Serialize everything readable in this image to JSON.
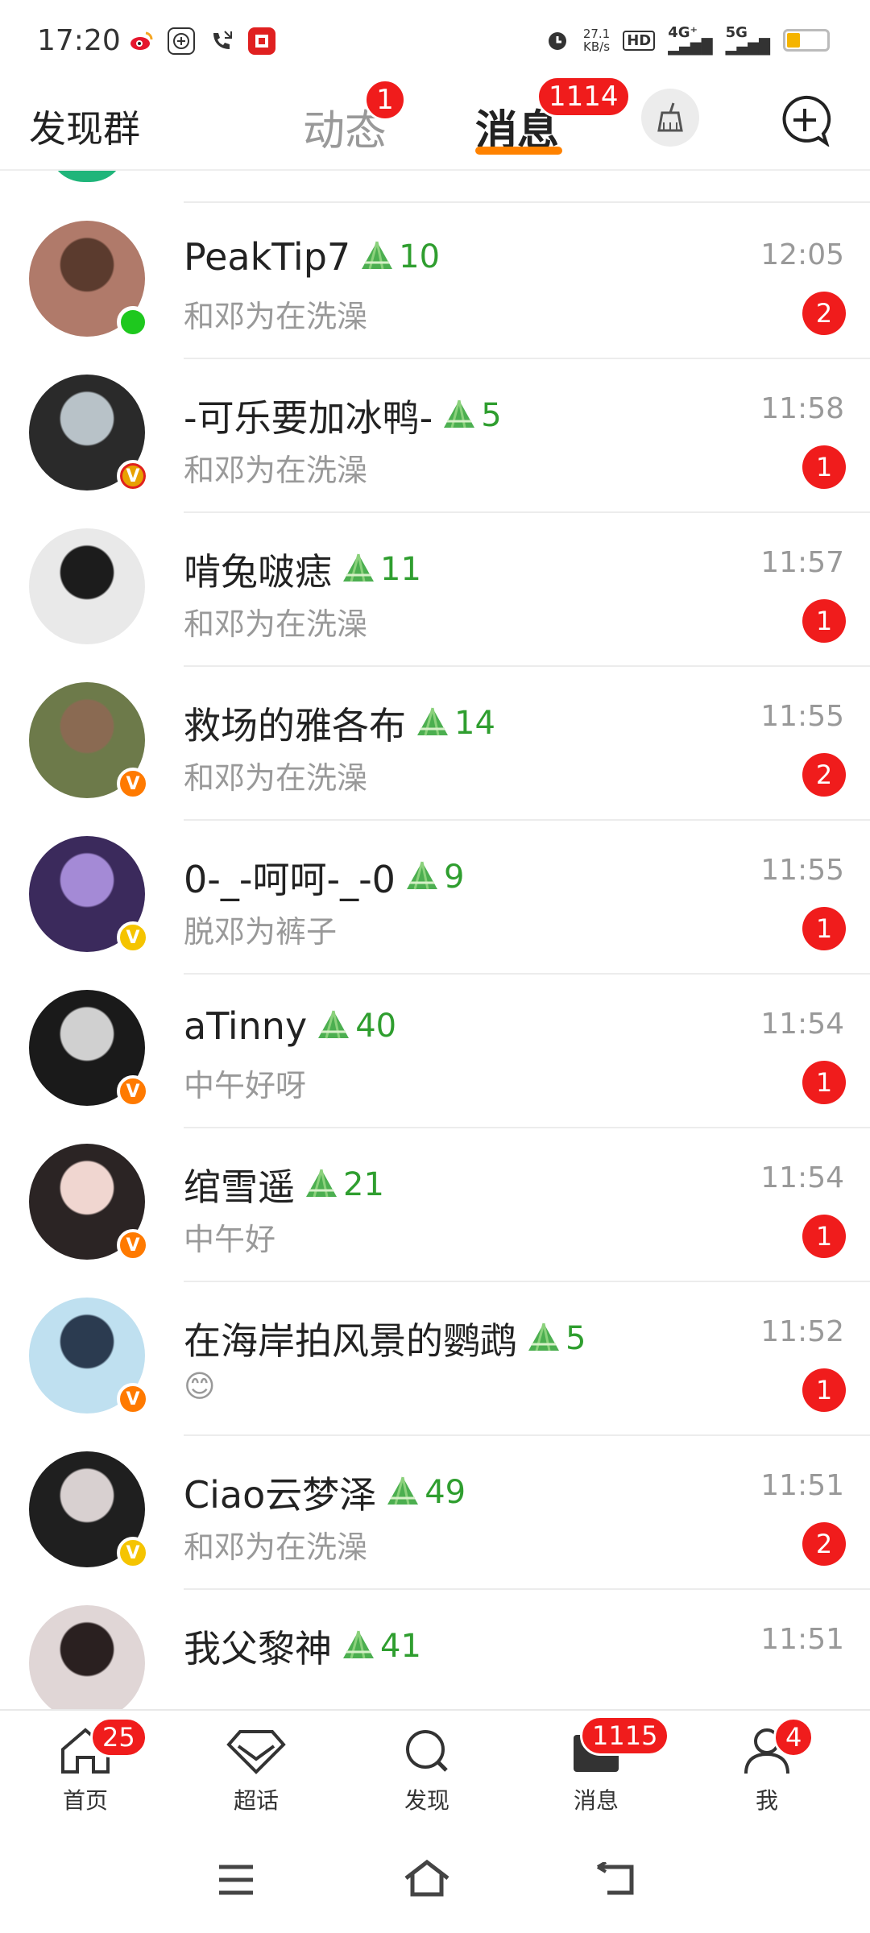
{
  "status_bar": {
    "time": "17:20",
    "speed_value": "27.1",
    "speed_unit": "KB/s",
    "hd": "HD",
    "net1": "4G⁺",
    "net2": "5G"
  },
  "top_nav": {
    "left_label": "发现群",
    "tab_dynamics": "动态",
    "tab_dynamics_badge": "1",
    "tab_messages": "消息",
    "tab_messages_badge": "1114"
  },
  "conversations": [
    {
      "name": "PeakTip7",
      "level": "10",
      "preview": "和邓为在洗澡",
      "time": "12:05",
      "unread": "2"
    },
    {
      "name": "-可乐要加冰鸭-",
      "level": "5",
      "preview": "和邓为在洗澡",
      "time": "11:58",
      "unread": "1"
    },
    {
      "name": "啃兔啵痣",
      "level": "11",
      "preview": "和邓为在洗澡",
      "time": "11:57",
      "unread": "1"
    },
    {
      "name": "救场的雅各布",
      "level": "14",
      "preview": "和邓为在洗澡",
      "time": "11:55",
      "unread": "2"
    },
    {
      "name": "0-_-呵呵-_-0",
      "level": "9",
      "preview": "脱邓为裤子",
      "time": "11:55",
      "unread": "1"
    },
    {
      "name": "aTinny",
      "level": "40",
      "preview": "中午好呀",
      "time": "11:54",
      "unread": "1"
    },
    {
      "name": "绾雪遥",
      "level": "21",
      "preview": "中午好",
      "time": "11:54",
      "unread": "1"
    },
    {
      "name": "在海岸拍风景的鹦鹉",
      "level": "5",
      "preview": "😊",
      "time": "11:52",
      "unread": "1"
    },
    {
      "name": "Ciao云梦泽",
      "level": "49",
      "preview": "和邓为在洗澡",
      "time": "11:51",
      "unread": "2"
    },
    {
      "name": "我父黎神",
      "level": "41",
      "preview": "",
      "time": "11:51",
      "unread": ""
    }
  ],
  "tabbar": {
    "home": "首页",
    "home_badge": "25",
    "topics": "超话",
    "discover": "发现",
    "messages": "消息",
    "messages_badge": "1115",
    "me": "我",
    "me_badge": "4"
  },
  "colors": {
    "accent": "#ff8200",
    "badge": "#f01c1c",
    "level_green": "#2f9e2f",
    "online": "#1ec81e"
  }
}
